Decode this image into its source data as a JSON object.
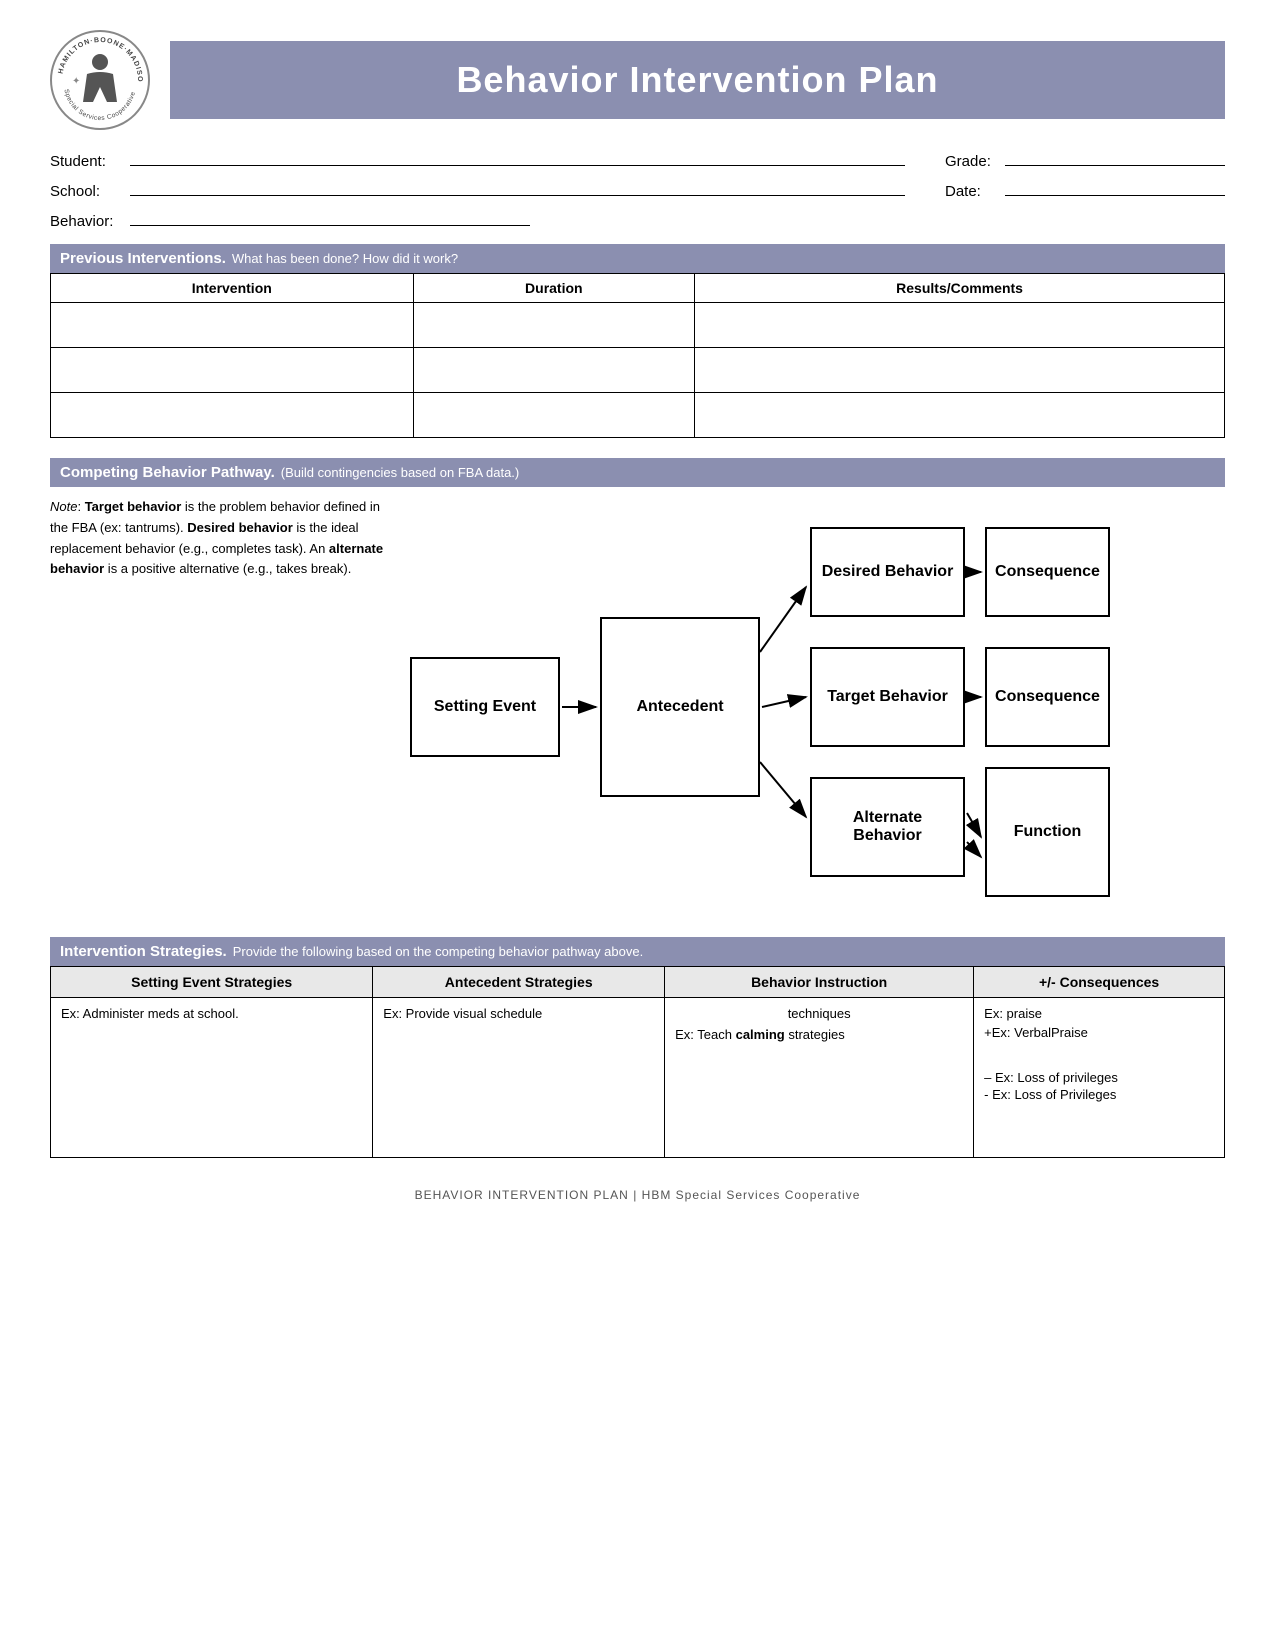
{
  "header": {
    "title": "Behavior Intervention Plan",
    "logo_top_text": "HAMILTON·BOONE·MADISON",
    "logo_bottom_text": "Special Services Cooperative"
  },
  "fields": {
    "student_label": "Student:",
    "grade_label": "Grade:",
    "school_label": "School:",
    "date_label": "Date:",
    "behavior_label": "Behavior:"
  },
  "previous_interventions": {
    "section_title": "Previous Interventions.",
    "section_sub": "What has been done? How did it work?",
    "col_intervention": "Intervention",
    "col_duration": "Duration",
    "col_results": "Results/Comments"
  },
  "competing_behavior": {
    "section_title": "Competing Behavior Pathway.",
    "section_sub": "(Build contingencies based on FBA data.)",
    "note_text": "Note: Target behavior is the problem behavior defined in the FBA (ex: tantrums). Desired behavior is the ideal replacement behavior (e.g., completes task). An alternate behavior is a positive alternative (e.g., takes break).",
    "box_setting": "Setting Event",
    "box_antecedent": "Antecedent",
    "box_desired": "Desired Behavior",
    "box_target": "Target Behavior",
    "box_alternate": "Alternate Behavior",
    "box_consequence_top": "Consequence",
    "box_consequence_mid": "Consequence",
    "box_function": "Function"
  },
  "intervention_strategies": {
    "section_title": "Intervention Strategies.",
    "section_sub": "Provide the following based on the competing behavior pathway above.",
    "col_setting": "Setting Event Strategies",
    "col_antecedent": "Antecedent Strategies",
    "col_behavior": "Behavior Instruction",
    "col_consequences": "+/- Consequences",
    "row1_setting": "Ex: Administer meds at school.",
    "row1_antecedent": "Ex: Provide visual schedule",
    "row1_behavior_line1": "techniques",
    "row1_behavior_line2": "Ex: Teach calming strategies",
    "row1_consequences_line1": "Ex:        praise",
    "row1_consequences_line2": "+Ex: VerbalPraise",
    "row1_consequences_line3": "– Ex: Loss of privileges",
    "row1_consequences_line4": "- Ex: Loss of Privileges"
  },
  "footer": {
    "text": "BEHAVIOR INTERVENTION PLAN",
    "separator": "|",
    "org": "HBM Special Services Cooperative"
  }
}
